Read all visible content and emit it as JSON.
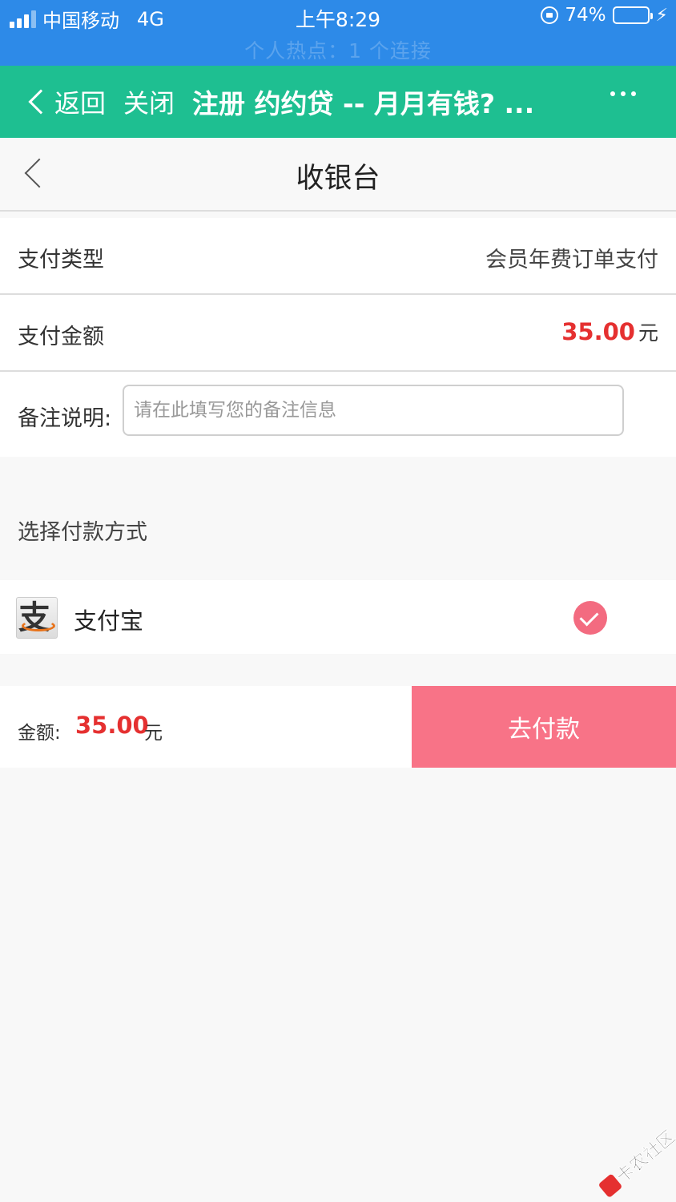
{
  "status_bar": {
    "carrier": "中国移动",
    "network": "4G",
    "time": "上午8:29",
    "battery": "74%",
    "battery_level": 0.74,
    "hotspot": "个人热点：1 个连接"
  },
  "browser_bar": {
    "back_label": "返回",
    "close_label": "关闭",
    "title": "注册 约约贷 -- 月月有钱? ..."
  },
  "nav": {
    "title": "收银台"
  },
  "payment_type": {
    "label": "支付类型",
    "value": "会员年费订单支付"
  },
  "payment_amount": {
    "label": "支付金额",
    "value": "35.00",
    "unit": "元"
  },
  "note": {
    "label": "备注说明:",
    "placeholder": "请在此填写您的备注信息"
  },
  "methods": {
    "title": "选择付款方式",
    "items": [
      {
        "name": "支付宝",
        "logo_text": "支",
        "selected": true
      }
    ]
  },
  "footer": {
    "amount_label": "金额:",
    "amount": "35.00",
    "unit": "元",
    "pay_button": "去付款"
  },
  "watermark": {
    "text": "卡农社区"
  },
  "colors": {
    "status_bar": "#2d8ae8",
    "browser_bar": "#1ebf91",
    "amount_red": "#e53030",
    "pay_button": "#f87387",
    "check": "#f36b80"
  }
}
